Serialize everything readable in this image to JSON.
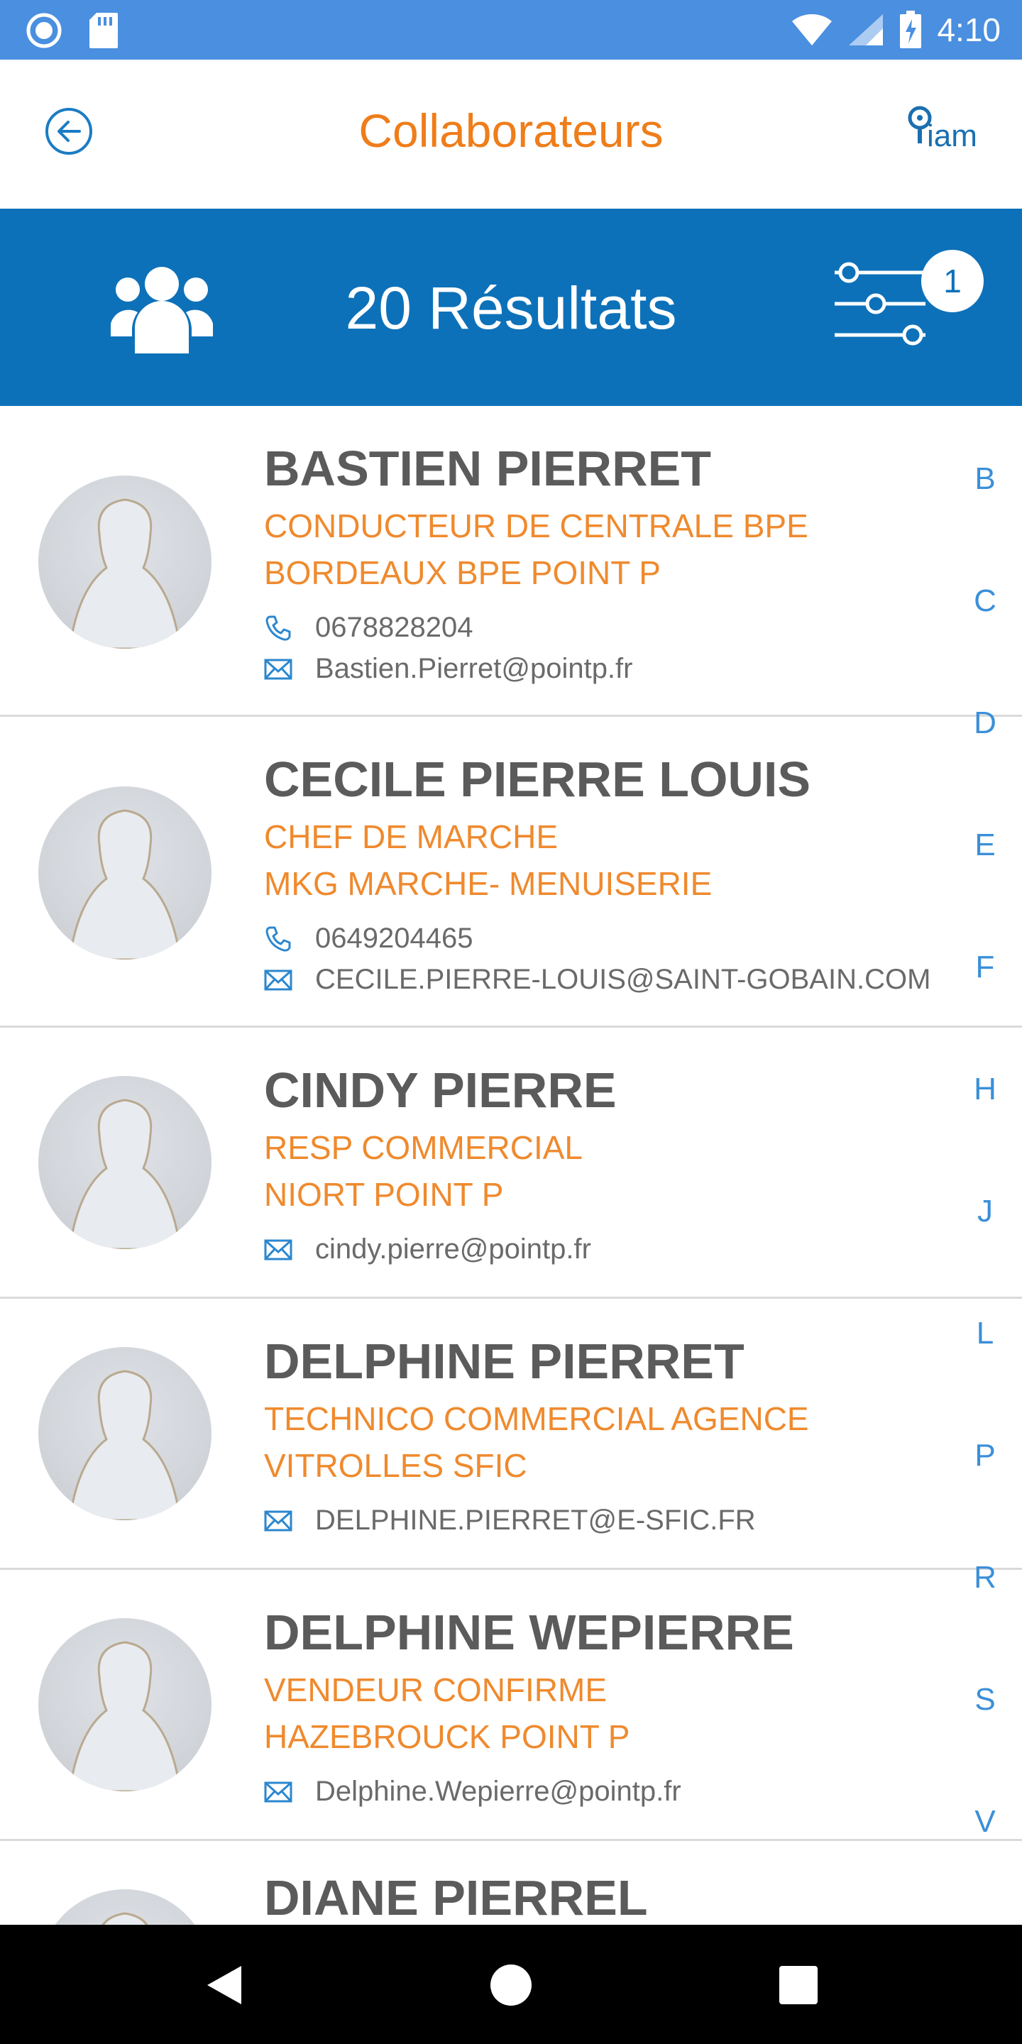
{
  "status_bar": {
    "time": "4:10"
  },
  "app_bar": {
    "title": "Collaborateurs",
    "logo_text": "iam"
  },
  "results": {
    "label": "20 Résultats",
    "filter_count": "1"
  },
  "contacts": [
    {
      "name": "BASTIEN PIERRET",
      "role": "CONDUCTEUR DE CENTRALE BPE",
      "dept": "BORDEAUX BPE POINT P",
      "phone": "0678828204",
      "email": "Bastien.Pierret@pointp.fr"
    },
    {
      "name": "CECILE PIERRE LOUIS",
      "role": "CHEF DE MARCHE",
      "dept": "MKG MARCHE- MENUISERIE",
      "phone": "0649204465",
      "email": "CECILE.PIERRE-LOUIS@SAINT-GOBAIN.COM"
    },
    {
      "name": "CINDY PIERRE",
      "role": "RESP COMMERCIAL",
      "dept": "NIORT POINT P",
      "email": "cindy.pierre@pointp.fr"
    },
    {
      "name": "DELPHINE PIERRET",
      "role": "TECHNICO COMMERCIAL AGENCE",
      "dept": "VITROLLES SFIC",
      "email": "DELPHINE.PIERRET@E-SFIC.FR"
    },
    {
      "name": "DELPHINE WEPIERRE",
      "role": "VENDEUR CONFIRME",
      "dept": "HAZEBROUCK POINT P",
      "email": "Delphine.Wepierre@pointp.fr"
    },
    {
      "name": "DIANE PIERREL"
    }
  ],
  "alpha_index": [
    "B",
    "C",
    "D",
    "E",
    "F",
    "H",
    "J",
    "L",
    "P",
    "R",
    "S",
    "V"
  ],
  "colors": {
    "status_bar": "#4a8fe0",
    "banner": "#0d71b9",
    "accent_orange": "#ef7d1a",
    "index_blue": "#3b8fd8"
  },
  "icons": {
    "back": "back-arrow-icon",
    "people": "people-icon",
    "filter": "filter-sliders-icon",
    "phone": "phone-icon",
    "mail": "mail-icon"
  }
}
